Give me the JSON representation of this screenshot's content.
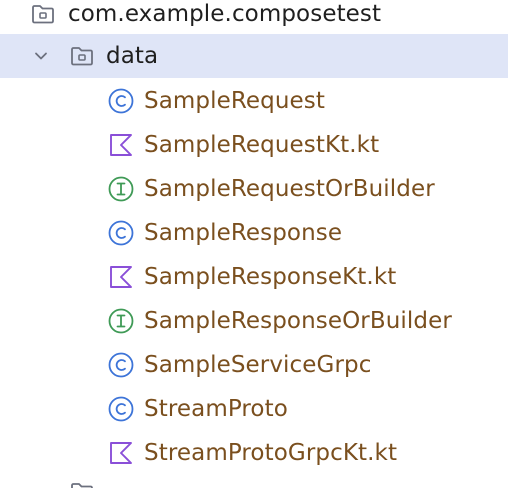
{
  "colors": {
    "selection_bg": "#dfe5f7",
    "package_text": "#1f1f1f",
    "class_text": "#7a4f1e",
    "class_icon": "#3d74d8",
    "interface_icon": "#3f9a56",
    "kotlin_file_icon": "#8a4fd8",
    "folder_icon": "#6c707e"
  },
  "tree": {
    "root_package": {
      "label": "com.example.composetest",
      "icon": "package-folder-icon"
    },
    "data_package": {
      "label": "data",
      "icon": "package-folder-icon",
      "expanded": true,
      "selected": true
    },
    "children": [
      {
        "label": "SampleRequest",
        "kind": "class",
        "icon": "class-icon"
      },
      {
        "label": "SampleRequestKt.kt",
        "kind": "kotlin-file",
        "icon": "kotlin-file-icon"
      },
      {
        "label": "SampleRequestOrBuilder",
        "kind": "interface",
        "icon": "interface-icon"
      },
      {
        "label": "SampleResponse",
        "kind": "class",
        "icon": "class-icon"
      },
      {
        "label": "SampleResponseKt.kt",
        "kind": "kotlin-file",
        "icon": "kotlin-file-icon"
      },
      {
        "label": "SampleResponseOrBuilder",
        "kind": "interface",
        "icon": "interface-icon"
      },
      {
        "label": "SampleServiceGrpc",
        "kind": "class",
        "icon": "class-icon"
      },
      {
        "label": "StreamProto",
        "kind": "class",
        "icon": "class-icon"
      },
      {
        "label": "StreamProtoGrpcKt.kt",
        "kind": "kotlin-file",
        "icon": "kotlin-file-icon"
      }
    ]
  }
}
